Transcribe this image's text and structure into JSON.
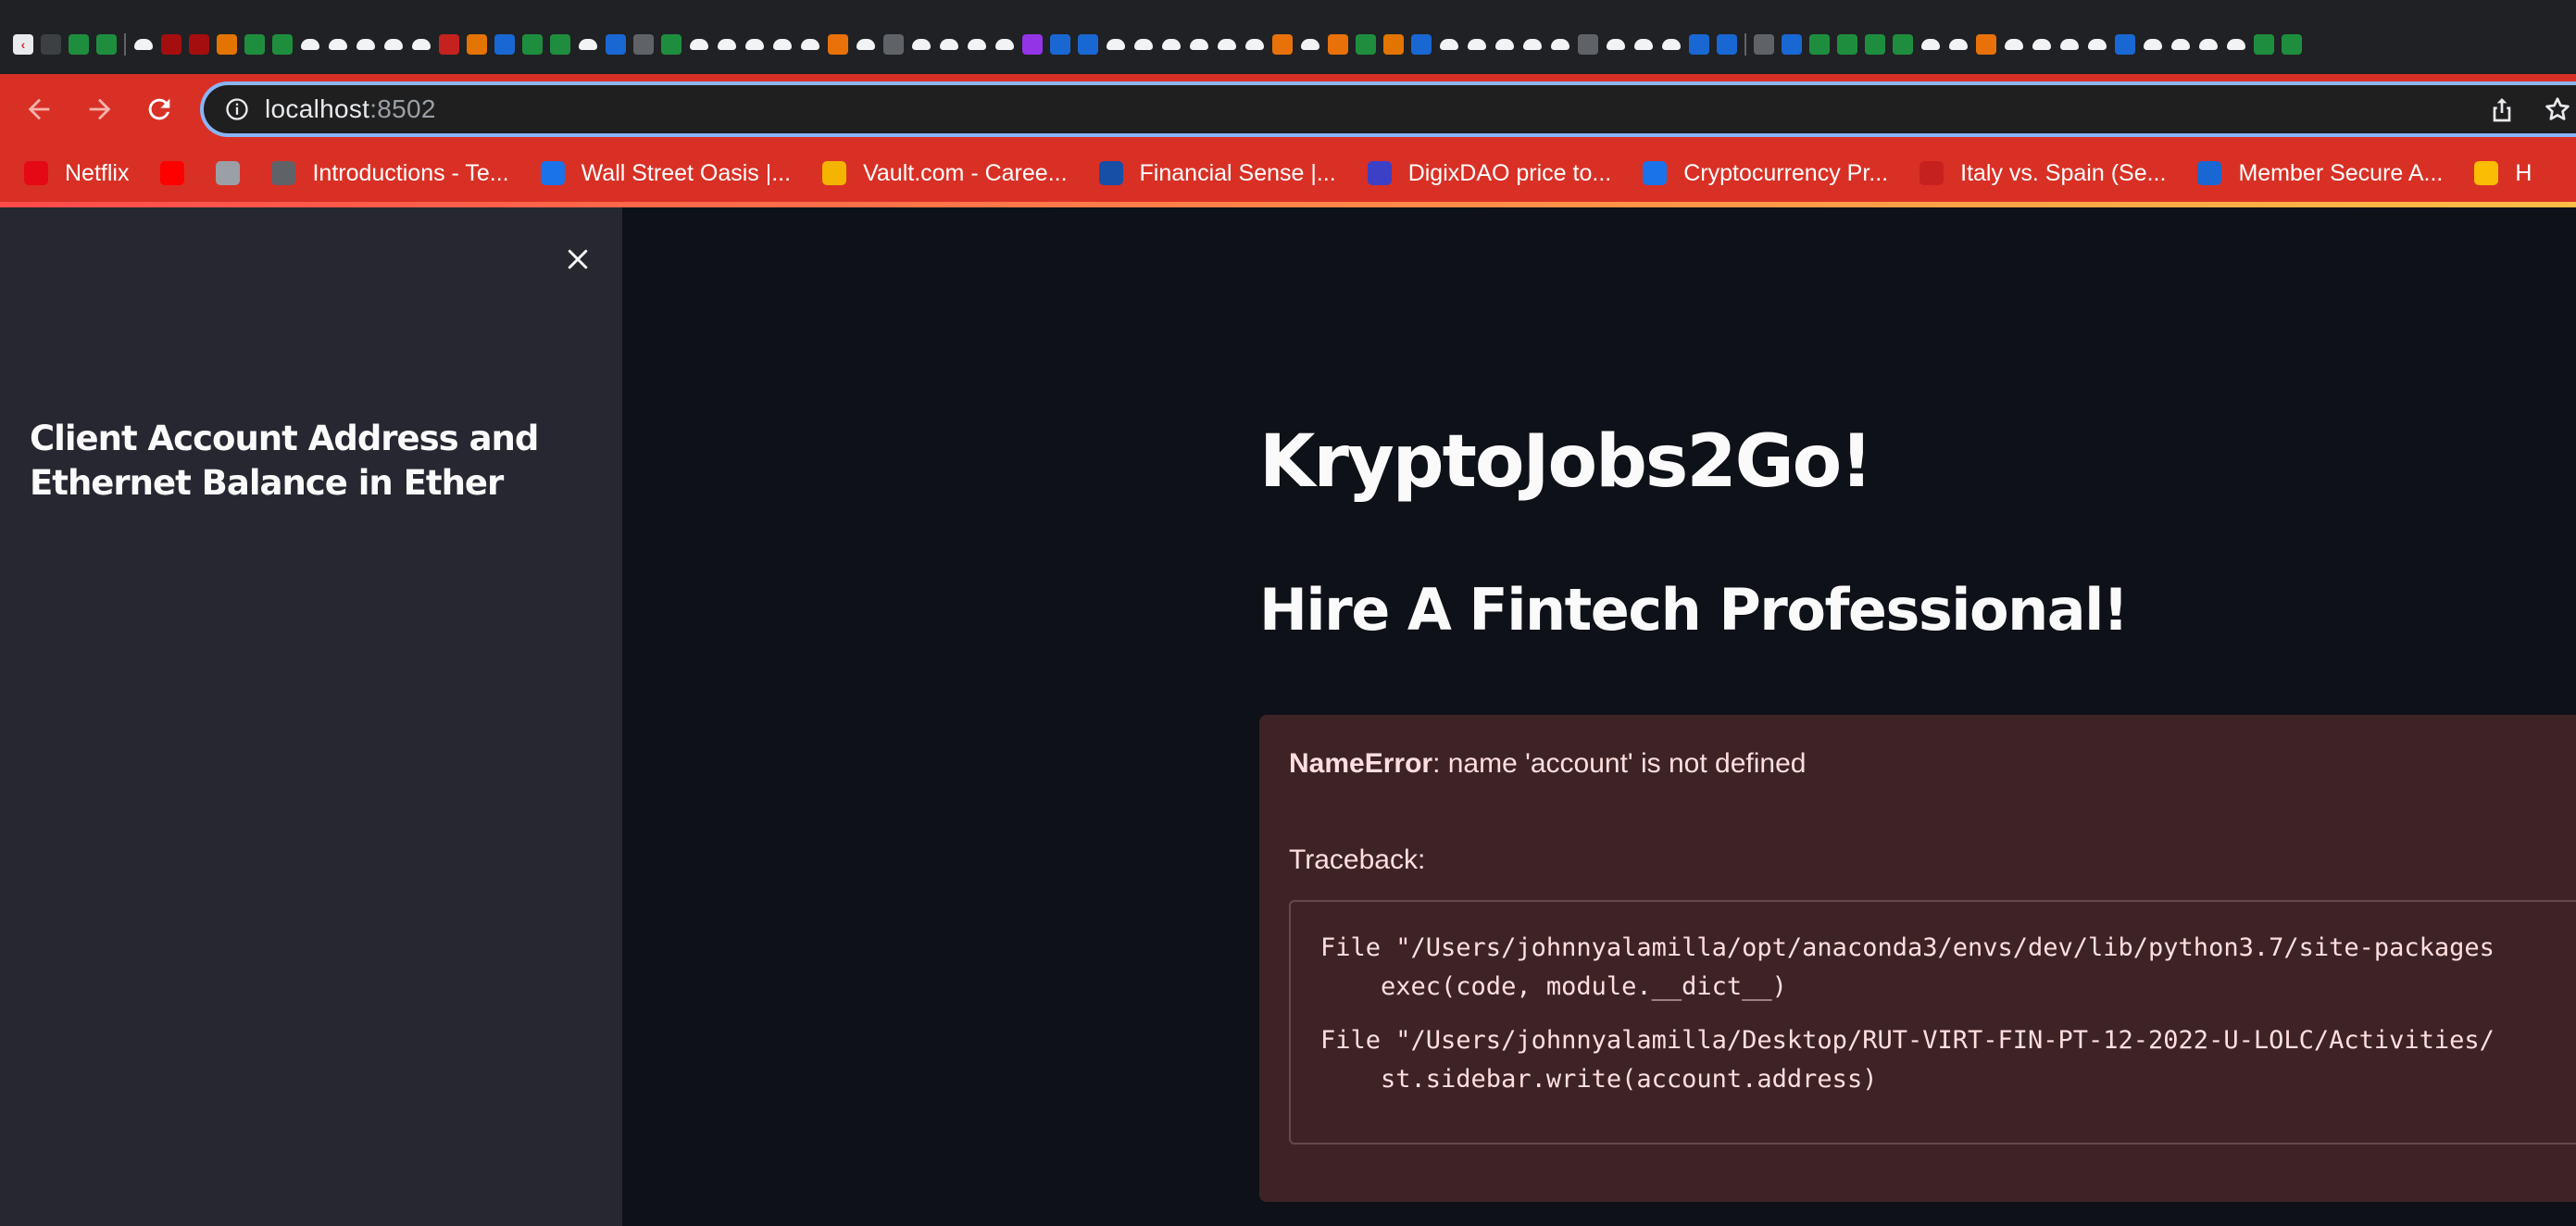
{
  "browser": {
    "address_bar": {
      "host": "localhost",
      "port": ":8502"
    },
    "bookmarks": [
      {
        "label": "Netflix",
        "icon": "netflix-icon",
        "color": "#e50914"
      },
      {
        "label": "",
        "icon": "youtube-icon",
        "color": "#ff0000"
      },
      {
        "label": "",
        "icon": "globe-icon",
        "color": "#9aa0a6"
      },
      {
        "label": "Introductions - Te...",
        "icon": "page-icon",
        "color": "#5f6368"
      },
      {
        "label": "Wall Street Oasis |...",
        "icon": "globe-icon",
        "color": "#1a73e8"
      },
      {
        "label": "Vault.com - Caree...",
        "icon": "vault-icon",
        "color": "#f4b400"
      },
      {
        "label": "Financial Sense |...",
        "icon": "lighthouse-icon",
        "color": "#174ea6"
      },
      {
        "label": "DigixDAO price to...",
        "icon": "coin-icon",
        "color": "#3c40c6"
      },
      {
        "label": "Cryptocurrency Pr...",
        "icon": "coin-icon",
        "color": "#1a73e8"
      },
      {
        "label": "Italy vs. Spain (Se...",
        "icon": "flag-icon",
        "color": "#c5221f"
      },
      {
        "label": "Member Secure A...",
        "icon": "shield-icon",
        "color": "#1967d2"
      },
      {
        "label": "H",
        "icon": "pen-icon",
        "color": "#fbbc04"
      }
    ]
  },
  "app": {
    "sidebar": {
      "title": "Client Account Address and Ethernet Balance in Ether"
    },
    "main": {
      "title": "KryptoJobs2Go!",
      "subtitle": "Hire A Fintech Professional!"
    },
    "error": {
      "type": "NameError",
      "message": ": name 'account' is not defined",
      "traceback_label": "Traceback:",
      "lines": [
        "File \"/Users/johnnyalamilla/opt/anaconda3/envs/dev/lib/python3.7/site-packages",
        "    exec(code, module.__dict__)",
        "File \"/Users/johnnyalamilla/Desktop/RUT-VIRT-FIN-PT-12-2022-U-LOLC/Activities/",
        "    st.sidebar.write(account.address)"
      ]
    }
  },
  "colors": {
    "accent": "#d93025",
    "app_background": "#0e1117",
    "sidebar_background": "#262730",
    "error_background": "#3e2326"
  }
}
